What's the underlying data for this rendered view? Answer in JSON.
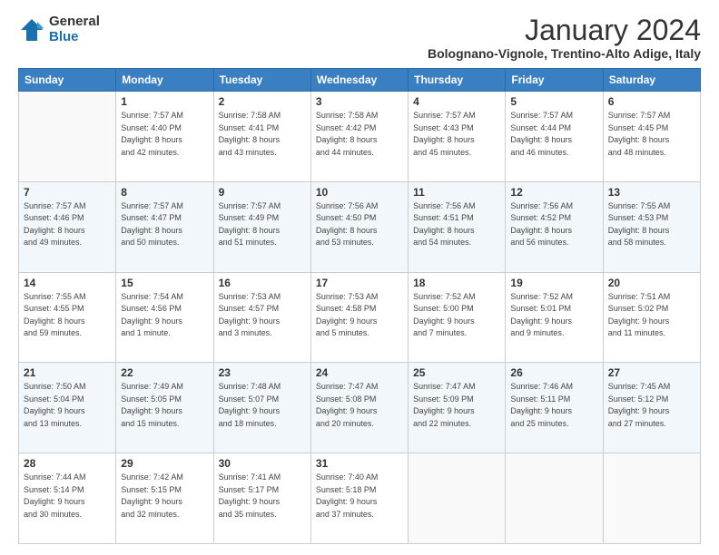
{
  "logo": {
    "general": "General",
    "blue": "Blue"
  },
  "header": {
    "month": "January 2024",
    "location": "Bolognano-Vignole, Trentino-Alto Adige, Italy"
  },
  "weekdays": [
    "Sunday",
    "Monday",
    "Tuesday",
    "Wednesday",
    "Thursday",
    "Friday",
    "Saturday"
  ],
  "weeks": [
    [
      {
        "day": "",
        "info": ""
      },
      {
        "day": "1",
        "info": "Sunrise: 7:57 AM\nSunset: 4:40 PM\nDaylight: 8 hours\nand 42 minutes."
      },
      {
        "day": "2",
        "info": "Sunrise: 7:58 AM\nSunset: 4:41 PM\nDaylight: 8 hours\nand 43 minutes."
      },
      {
        "day": "3",
        "info": "Sunrise: 7:58 AM\nSunset: 4:42 PM\nDaylight: 8 hours\nand 44 minutes."
      },
      {
        "day": "4",
        "info": "Sunrise: 7:57 AM\nSunset: 4:43 PM\nDaylight: 8 hours\nand 45 minutes."
      },
      {
        "day": "5",
        "info": "Sunrise: 7:57 AM\nSunset: 4:44 PM\nDaylight: 8 hours\nand 46 minutes."
      },
      {
        "day": "6",
        "info": "Sunrise: 7:57 AM\nSunset: 4:45 PM\nDaylight: 8 hours\nand 48 minutes."
      }
    ],
    [
      {
        "day": "7",
        "info": "Sunrise: 7:57 AM\nSunset: 4:46 PM\nDaylight: 8 hours\nand 49 minutes."
      },
      {
        "day": "8",
        "info": "Sunrise: 7:57 AM\nSunset: 4:47 PM\nDaylight: 8 hours\nand 50 minutes."
      },
      {
        "day": "9",
        "info": "Sunrise: 7:57 AM\nSunset: 4:49 PM\nDaylight: 8 hours\nand 51 minutes."
      },
      {
        "day": "10",
        "info": "Sunrise: 7:56 AM\nSunset: 4:50 PM\nDaylight: 8 hours\nand 53 minutes."
      },
      {
        "day": "11",
        "info": "Sunrise: 7:56 AM\nSunset: 4:51 PM\nDaylight: 8 hours\nand 54 minutes."
      },
      {
        "day": "12",
        "info": "Sunrise: 7:56 AM\nSunset: 4:52 PM\nDaylight: 8 hours\nand 56 minutes."
      },
      {
        "day": "13",
        "info": "Sunrise: 7:55 AM\nSunset: 4:53 PM\nDaylight: 8 hours\nand 58 minutes."
      }
    ],
    [
      {
        "day": "14",
        "info": "Sunrise: 7:55 AM\nSunset: 4:55 PM\nDaylight: 8 hours\nand 59 minutes."
      },
      {
        "day": "15",
        "info": "Sunrise: 7:54 AM\nSunset: 4:56 PM\nDaylight: 9 hours\nand 1 minute."
      },
      {
        "day": "16",
        "info": "Sunrise: 7:53 AM\nSunset: 4:57 PM\nDaylight: 9 hours\nand 3 minutes."
      },
      {
        "day": "17",
        "info": "Sunrise: 7:53 AM\nSunset: 4:58 PM\nDaylight: 9 hours\nand 5 minutes."
      },
      {
        "day": "18",
        "info": "Sunrise: 7:52 AM\nSunset: 5:00 PM\nDaylight: 9 hours\nand 7 minutes."
      },
      {
        "day": "19",
        "info": "Sunrise: 7:52 AM\nSunset: 5:01 PM\nDaylight: 9 hours\nand 9 minutes."
      },
      {
        "day": "20",
        "info": "Sunrise: 7:51 AM\nSunset: 5:02 PM\nDaylight: 9 hours\nand 11 minutes."
      }
    ],
    [
      {
        "day": "21",
        "info": "Sunrise: 7:50 AM\nSunset: 5:04 PM\nDaylight: 9 hours\nand 13 minutes."
      },
      {
        "day": "22",
        "info": "Sunrise: 7:49 AM\nSunset: 5:05 PM\nDaylight: 9 hours\nand 15 minutes."
      },
      {
        "day": "23",
        "info": "Sunrise: 7:48 AM\nSunset: 5:07 PM\nDaylight: 9 hours\nand 18 minutes."
      },
      {
        "day": "24",
        "info": "Sunrise: 7:47 AM\nSunset: 5:08 PM\nDaylight: 9 hours\nand 20 minutes."
      },
      {
        "day": "25",
        "info": "Sunrise: 7:47 AM\nSunset: 5:09 PM\nDaylight: 9 hours\nand 22 minutes."
      },
      {
        "day": "26",
        "info": "Sunrise: 7:46 AM\nSunset: 5:11 PM\nDaylight: 9 hours\nand 25 minutes."
      },
      {
        "day": "27",
        "info": "Sunrise: 7:45 AM\nSunset: 5:12 PM\nDaylight: 9 hours\nand 27 minutes."
      }
    ],
    [
      {
        "day": "28",
        "info": "Sunrise: 7:44 AM\nSunset: 5:14 PM\nDaylight: 9 hours\nand 30 minutes."
      },
      {
        "day": "29",
        "info": "Sunrise: 7:42 AM\nSunset: 5:15 PM\nDaylight: 9 hours\nand 32 minutes."
      },
      {
        "day": "30",
        "info": "Sunrise: 7:41 AM\nSunset: 5:17 PM\nDaylight: 9 hours\nand 35 minutes."
      },
      {
        "day": "31",
        "info": "Sunrise: 7:40 AM\nSunset: 5:18 PM\nDaylight: 9 hours\nand 37 minutes."
      },
      {
        "day": "",
        "info": ""
      },
      {
        "day": "",
        "info": ""
      },
      {
        "day": "",
        "info": ""
      }
    ]
  ]
}
